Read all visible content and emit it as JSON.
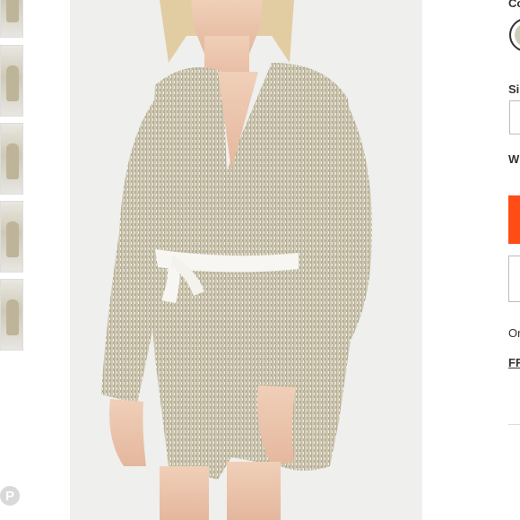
{
  "product_panel": {
    "color_label": "Co",
    "size_label": "Si",
    "waitlist_text": "W",
    "order_text": "Or",
    "free_link": "FR",
    "pinterest_icon": "P",
    "accent_color": "#ff4d15",
    "swatch_color": "#cfcbb8"
  },
  "thumbnails": [
    "thumb-1",
    "thumb-2",
    "thumb-3",
    "thumb-4",
    "thumb-5"
  ],
  "icons": {
    "pinterest": "pinterest-icon",
    "color_swatch": "color-swatch-icon"
  }
}
